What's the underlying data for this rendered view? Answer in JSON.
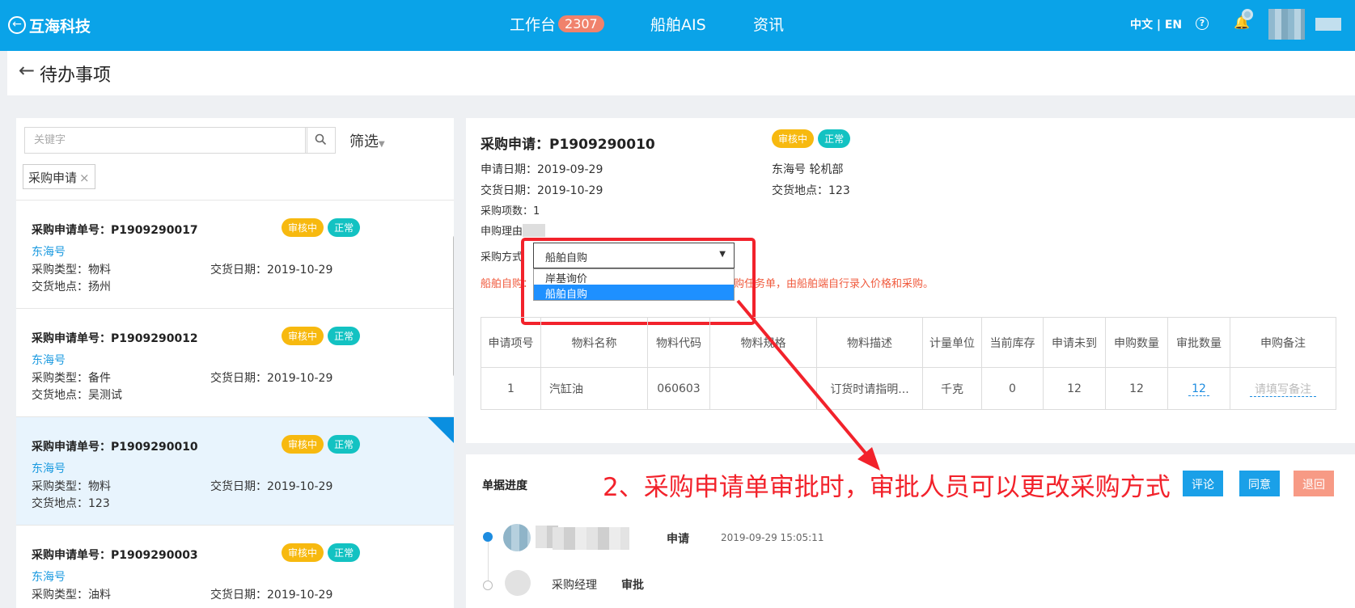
{
  "topbar": {
    "brand": "互海科技",
    "nav_workbench": "工作台",
    "badge": "2307",
    "nav_ais": "船舶AIS",
    "nav_news": "资讯",
    "lang": "中文 | EN",
    "help": "?",
    "bell": "🔔"
  },
  "subhead": {
    "back": "←",
    "title": "待办事项"
  },
  "search": {
    "placeholder": "关键字",
    "filter": "筛选",
    "tag": "采购申请",
    "tag_close": "×"
  },
  "list": [
    {
      "title": "采购申请单号：P1909290017",
      "status": "审核中",
      "priority": "正常",
      "ship": "东海号",
      "type": "采购类型：物料",
      "date": "交货日期：2019-10-29",
      "place": "交货地点：扬州"
    },
    {
      "title": "采购申请单号：P1909290012",
      "status": "审核中",
      "priority": "正常",
      "ship": "东海号",
      "type": "采购类型：备件",
      "date": "交货日期：2019-10-29",
      "place": "交货地点：吴测试"
    },
    {
      "title": "采购申请单号：P1909290010",
      "status": "审核中",
      "priority": "正常",
      "ship": "东海号",
      "type": "采购类型：物料",
      "date": "交货日期：2019-10-29",
      "place": "交货地点：123"
    },
    {
      "title": "采购申请单号：P1909290003",
      "status": "审核中",
      "priority": "正常",
      "ship": "东海号",
      "type": "采购类型：油料",
      "date": "交货日期：2019-10-29",
      "place": ""
    }
  ],
  "detail": {
    "title": "采购申请：P1909290010",
    "status": "审核中",
    "priority": "正常",
    "apply_date": "申请日期：2019-09-29",
    "delivery_date": "交货日期：2019-10-29",
    "item_count": "采购项数：1",
    "manager": "申购理由",
    "ship_dept": "东海号 轮机部",
    "delivery_place": "交货地点：123",
    "method_label": "采购方式",
    "method_value": "船舶自购",
    "options": [
      "岸基询价",
      "船舶自购"
    ],
    "warn_prefix": "船舶自购：",
    "warn_suffix": "购任务单，由船舶端自行录入价格和采购。"
  },
  "table": {
    "headers": [
      "申请项号",
      "物料名称",
      "物料代码",
      "物料规格",
      "物料描述",
      "计量单位",
      "当前库存",
      "申请未到",
      "申购数量",
      "审批数量",
      "申购备注"
    ],
    "row": [
      "1",
      "汽缸油",
      "060603",
      "",
      "订货时请指明...",
      "千克",
      "0",
      "12",
      "12",
      "12",
      "请填写备注"
    ]
  },
  "progress": {
    "title": "单据进度",
    "btn_comment": "评论",
    "btn_agree": "同意",
    "btn_return": "退回",
    "step1_action": "申请",
    "step1_time": "2019-09-29 15:05:11",
    "step2_role": "采购经理",
    "step2_action": "审批"
  },
  "annotation": "2、采购申请单审批时，审批人员可以更改采购方式",
  "colors": {
    "topbar": "#0aa3e8",
    "accent": "#1d9be0",
    "amber": "#f7b90f",
    "teal": "#13c2c2",
    "warn": "#f05a3d",
    "annot_red": "#f2222b",
    "btn_blue": "#1aa0e8",
    "btn_salmon": "#f79a85"
  }
}
